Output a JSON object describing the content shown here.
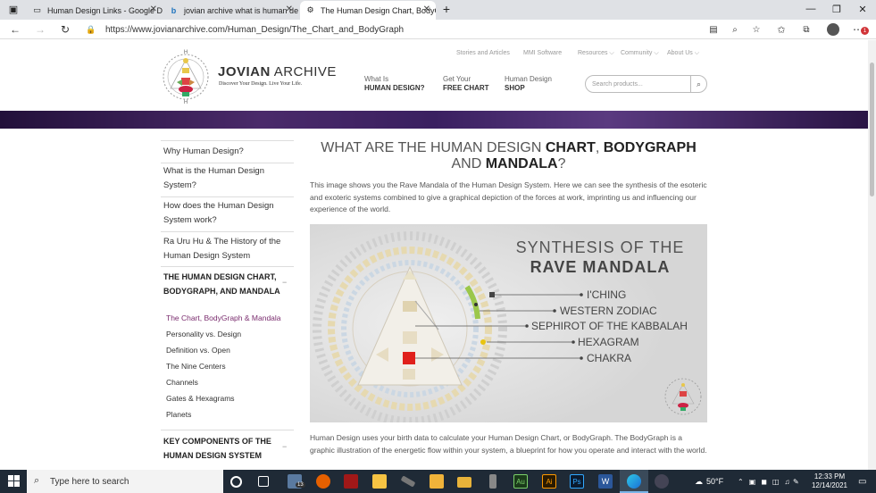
{
  "browser": {
    "tabs": [
      {
        "title": "Human Design Links - Google D",
        "icon": "doc-icon"
      },
      {
        "title": "jovian archive what is human de",
        "icon": "bing-icon"
      },
      {
        "title": "The Human Design Chart, BodyG",
        "icon": "jovian-icon"
      }
    ],
    "new_tab": "+",
    "url": "https://www.jovianarchive.com/Human_Design/The_Chart_and_BodyGraph",
    "profile_badge": "1"
  },
  "header": {
    "logo_title_bold": "JOVIAN",
    "logo_title_light": " ARCHIVE",
    "logo_tagline": "Discover Your Design. Live Your Life.",
    "top_links": [
      "Stories and Articles",
      "MMI Software",
      "Resources",
      "Community",
      "About Us"
    ],
    "nav": [
      {
        "top": "What Is",
        "bottom": "HUMAN DESIGN?"
      },
      {
        "top": "Get Your",
        "bottom": "FREE CHART"
      },
      {
        "top": "Human Design",
        "bottom": "SHOP"
      }
    ],
    "search_placeholder": "Search products..."
  },
  "sidebar": {
    "links": [
      "Why Human Design?",
      "What is the Human Design System?",
      "How does the Human Design System work?",
      "Ra Uru Hu & The History of the Human Design System"
    ],
    "section1": "THE HUMAN DESIGN CHART, BODYGRAPH, AND MANDALA",
    "sub_items": [
      "The Chart, BodyGraph & Mandala",
      "Personality vs. Design",
      "Definition vs. Open",
      "The Nine Centers",
      "Channels",
      "Gates & Hexagrams",
      "Planets"
    ],
    "active_sub": "The Chart, BodyGraph & Mandala",
    "section2": "KEY COMPONENTS OF THE HUMAN DESIGN SYSTEM",
    "accent_color": "#7a2c6e"
  },
  "main": {
    "title_part1": "WHAT ARE THE HUMAN DESIGN ",
    "title_bold1": "CHART",
    "title_part2": ", ",
    "title_bold2": "BODYGRAPH",
    "title_part3": " AND ",
    "title_bold3": "MANDALA",
    "title_part4": "?",
    "intro": "This image shows you the Rave Mandala of the Human Design System. Here we can see the synthesis of the esoteric and exoteric systems combined to give a graphical depiction of the forces at work, imprinting us and influencing our experience of the world.",
    "image": {
      "heading_line1": "SYNTHESIS OF THE",
      "heading_line2": "RAVE MANDALA",
      "labels": [
        "I'CHING",
        "WESTERN ZODIAC",
        "SEPHIROT OF THE KABBALAH",
        "HEXAGRAM",
        "CHAKRA"
      ]
    },
    "para2": "Human Design uses your birth data to calculate your Human Design Chart, or BodyGraph. The BodyGraph is a graphic illustration of the energetic flow within your system, a blueprint for how you operate and interact with the world."
  },
  "taskbar": {
    "search_placeholder": "Type here to search",
    "mail_badge": "13",
    "weather": "50°F",
    "time": "12:33 PM",
    "date": "12/14/2021"
  }
}
